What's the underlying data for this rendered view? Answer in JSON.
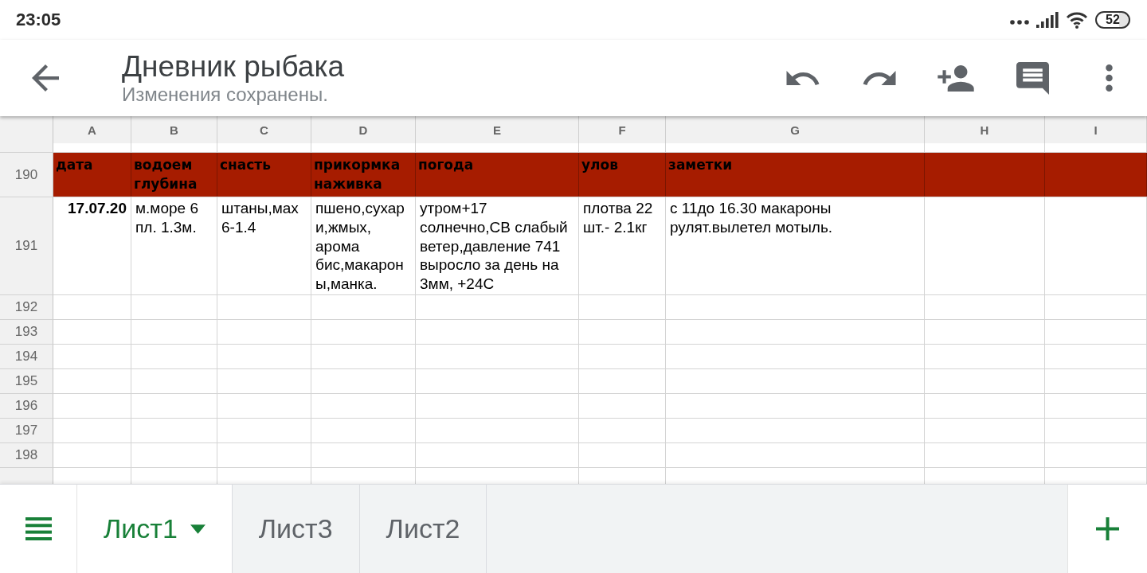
{
  "status_bar": {
    "time": "23:05",
    "battery": "52"
  },
  "app_bar": {
    "title": "Дневник рыбака",
    "subtitle": "Изменения сохранены."
  },
  "sheet": {
    "columns": [
      "A",
      "B",
      "C",
      "D",
      "E",
      "F",
      "G",
      "H",
      "I"
    ],
    "rows": [
      {
        "number": "190",
        "kind": "header",
        "cells": [
          {
            "text": "дата"
          },
          {
            "text": "водоем глубина"
          },
          {
            "text": "снасть"
          },
          {
            "text": "прикормка наживка"
          },
          {
            "text": "погода"
          },
          {
            "text": "улов"
          },
          {
            "text": "заметки"
          }
        ]
      },
      {
        "number": "191",
        "kind": "data",
        "cells": [
          {
            "text": "17.07.20",
            "kind": "date"
          },
          {
            "text": "м.море 6 пл. 1.3м.",
            "kind": "text"
          },
          {
            "text": "штаны,мах 6-1.4",
            "kind": "text"
          },
          {
            "text": "пшено,сухари,жмых, арома бис,макароны,манка.",
            "kind": "text"
          },
          {
            "text": "утром+17 солнечно,СВ слабый ветер,давление 741 выросло за день на 3мм, +24С",
            "kind": "text"
          },
          {
            "text": "плотва 22 шт.- 2.1кг",
            "kind": "text"
          },
          {
            "text": "с 11до 16.30 макароны рулят.вылетел мотыль.",
            "kind": "text"
          }
        ]
      },
      {
        "number": "192",
        "kind": "data"
      },
      {
        "number": "193",
        "kind": "data"
      },
      {
        "number": "194",
        "kind": "data"
      },
      {
        "number": "195",
        "kind": "data"
      },
      {
        "number": "196",
        "kind": "data"
      },
      {
        "number": "197",
        "kind": "data"
      },
      {
        "number": "198",
        "kind": "data"
      }
    ]
  },
  "sheet_tabs": [
    {
      "label": "Лист1",
      "selected": true
    },
    {
      "label": "Лист3",
      "selected": false
    },
    {
      "label": "Лист2",
      "selected": false
    }
  ]
}
